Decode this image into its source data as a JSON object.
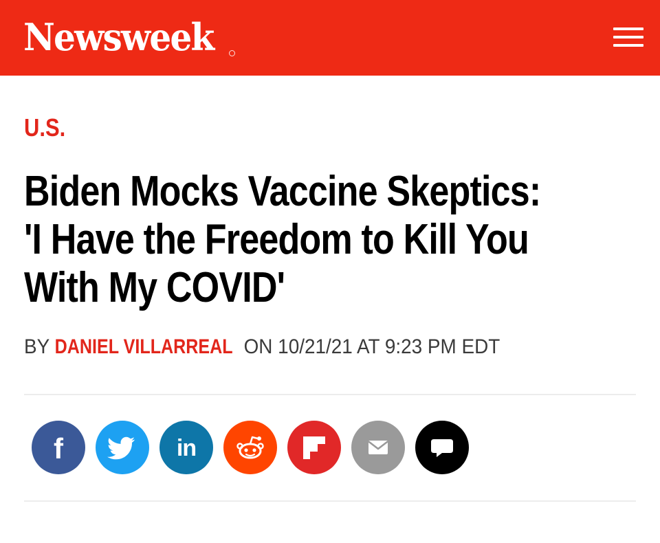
{
  "header": {
    "brand": "Newsweek",
    "brand_color": "#ee2a15",
    "menu_icon": "hamburger-menu-icon"
  },
  "article": {
    "section": "U.S.",
    "headline_line1": "Biden Mocks Vaccine Skeptics:",
    "headline_line2": "'I Have the Freedom to Kill You",
    "headline_line3": "With My COVID'",
    "by_prefix": "BY",
    "author": "DANIEL VILLARREAL",
    "date_text": "ON 10/21/21 AT 9:23 PM EDT"
  },
  "share": [
    {
      "name": "facebook",
      "icon": "facebook-icon",
      "color": "#3b5998"
    },
    {
      "name": "twitter",
      "icon": "twitter-icon",
      "color": "#1da1f2"
    },
    {
      "name": "linkedin",
      "icon": "linkedin-icon",
      "color": "#0e76a8"
    },
    {
      "name": "reddit",
      "icon": "reddit-icon",
      "color": "#ff4500"
    },
    {
      "name": "flipboard",
      "icon": "flipboard-icon",
      "color": "#e12828"
    },
    {
      "name": "email",
      "icon": "email-icon",
      "color": "#9a9a9a"
    },
    {
      "name": "comment",
      "icon": "comment-icon",
      "color": "#000000"
    }
  ],
  "accent_color": "#e2261b"
}
